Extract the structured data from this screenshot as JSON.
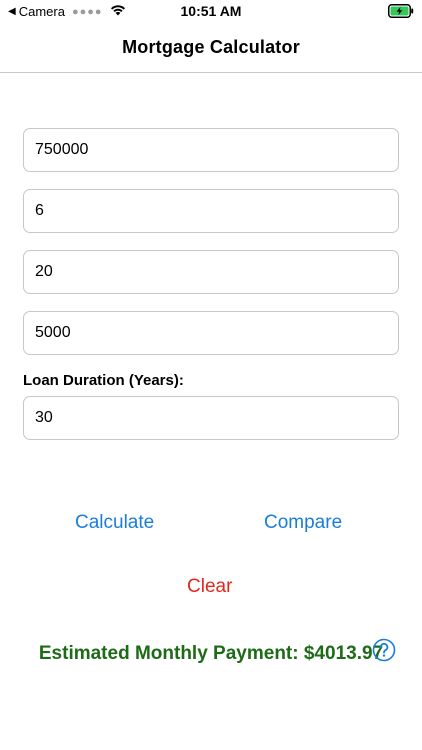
{
  "status_bar": {
    "back_app": "Camera",
    "time": "10:51 AM"
  },
  "nav": {
    "title": "Mortgage Calculator"
  },
  "fields": {
    "home_price": "750000",
    "interest_rate": "6",
    "down_payment": "20",
    "extra_amount": "5000",
    "duration_label": "Loan Duration (Years):",
    "duration": "30"
  },
  "buttons": {
    "calculate": "Calculate",
    "compare": "Compare",
    "clear": "Clear"
  },
  "result": {
    "text": "Estimated Monthly Payment: $4013.97"
  },
  "colors": {
    "link_blue": "#1a7ddb",
    "clear_red": "#e0281e",
    "result_green": "#1e6b17",
    "battery_green": "#34c759"
  },
  "icons": {
    "status": [
      "back-caret-icon",
      "wifi-icon",
      "battery-charging-icon"
    ],
    "help": "help-circle-icon"
  }
}
